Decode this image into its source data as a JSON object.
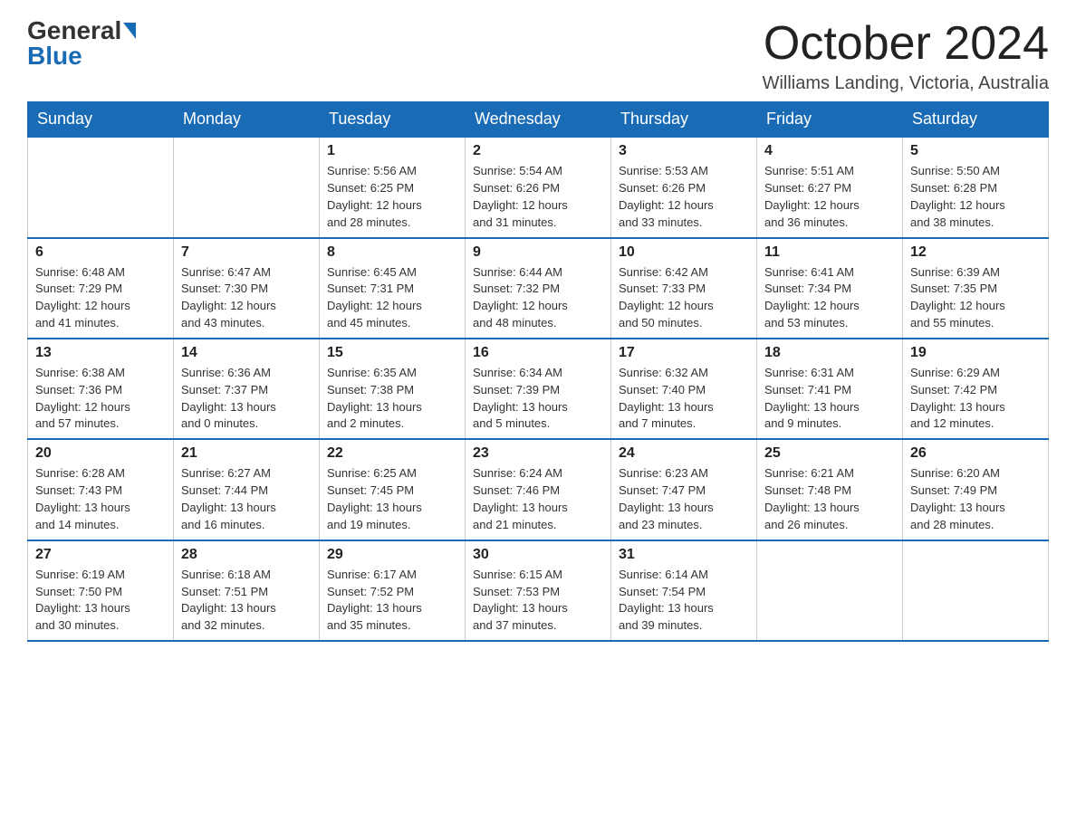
{
  "header": {
    "logo_line1": "General",
    "logo_arrow": "▶",
    "logo_line2": "Blue",
    "month_year": "October 2024",
    "location": "Williams Landing, Victoria, Australia"
  },
  "weekdays": [
    "Sunday",
    "Monday",
    "Tuesday",
    "Wednesday",
    "Thursday",
    "Friday",
    "Saturday"
  ],
  "weeks": [
    [
      {
        "day": "",
        "info": ""
      },
      {
        "day": "",
        "info": ""
      },
      {
        "day": "1",
        "info": "Sunrise: 5:56 AM\nSunset: 6:25 PM\nDaylight: 12 hours\nand 28 minutes."
      },
      {
        "day": "2",
        "info": "Sunrise: 5:54 AM\nSunset: 6:26 PM\nDaylight: 12 hours\nand 31 minutes."
      },
      {
        "day": "3",
        "info": "Sunrise: 5:53 AM\nSunset: 6:26 PM\nDaylight: 12 hours\nand 33 minutes."
      },
      {
        "day": "4",
        "info": "Sunrise: 5:51 AM\nSunset: 6:27 PM\nDaylight: 12 hours\nand 36 minutes."
      },
      {
        "day": "5",
        "info": "Sunrise: 5:50 AM\nSunset: 6:28 PM\nDaylight: 12 hours\nand 38 minutes."
      }
    ],
    [
      {
        "day": "6",
        "info": "Sunrise: 6:48 AM\nSunset: 7:29 PM\nDaylight: 12 hours\nand 41 minutes."
      },
      {
        "day": "7",
        "info": "Sunrise: 6:47 AM\nSunset: 7:30 PM\nDaylight: 12 hours\nand 43 minutes."
      },
      {
        "day": "8",
        "info": "Sunrise: 6:45 AM\nSunset: 7:31 PM\nDaylight: 12 hours\nand 45 minutes."
      },
      {
        "day": "9",
        "info": "Sunrise: 6:44 AM\nSunset: 7:32 PM\nDaylight: 12 hours\nand 48 minutes."
      },
      {
        "day": "10",
        "info": "Sunrise: 6:42 AM\nSunset: 7:33 PM\nDaylight: 12 hours\nand 50 minutes."
      },
      {
        "day": "11",
        "info": "Sunrise: 6:41 AM\nSunset: 7:34 PM\nDaylight: 12 hours\nand 53 minutes."
      },
      {
        "day": "12",
        "info": "Sunrise: 6:39 AM\nSunset: 7:35 PM\nDaylight: 12 hours\nand 55 minutes."
      }
    ],
    [
      {
        "day": "13",
        "info": "Sunrise: 6:38 AM\nSunset: 7:36 PM\nDaylight: 12 hours\nand 57 minutes."
      },
      {
        "day": "14",
        "info": "Sunrise: 6:36 AM\nSunset: 7:37 PM\nDaylight: 13 hours\nand 0 minutes."
      },
      {
        "day": "15",
        "info": "Sunrise: 6:35 AM\nSunset: 7:38 PM\nDaylight: 13 hours\nand 2 minutes."
      },
      {
        "day": "16",
        "info": "Sunrise: 6:34 AM\nSunset: 7:39 PM\nDaylight: 13 hours\nand 5 minutes."
      },
      {
        "day": "17",
        "info": "Sunrise: 6:32 AM\nSunset: 7:40 PM\nDaylight: 13 hours\nand 7 minutes."
      },
      {
        "day": "18",
        "info": "Sunrise: 6:31 AM\nSunset: 7:41 PM\nDaylight: 13 hours\nand 9 minutes."
      },
      {
        "day": "19",
        "info": "Sunrise: 6:29 AM\nSunset: 7:42 PM\nDaylight: 13 hours\nand 12 minutes."
      }
    ],
    [
      {
        "day": "20",
        "info": "Sunrise: 6:28 AM\nSunset: 7:43 PM\nDaylight: 13 hours\nand 14 minutes."
      },
      {
        "day": "21",
        "info": "Sunrise: 6:27 AM\nSunset: 7:44 PM\nDaylight: 13 hours\nand 16 minutes."
      },
      {
        "day": "22",
        "info": "Sunrise: 6:25 AM\nSunset: 7:45 PM\nDaylight: 13 hours\nand 19 minutes."
      },
      {
        "day": "23",
        "info": "Sunrise: 6:24 AM\nSunset: 7:46 PM\nDaylight: 13 hours\nand 21 minutes."
      },
      {
        "day": "24",
        "info": "Sunrise: 6:23 AM\nSunset: 7:47 PM\nDaylight: 13 hours\nand 23 minutes."
      },
      {
        "day": "25",
        "info": "Sunrise: 6:21 AM\nSunset: 7:48 PM\nDaylight: 13 hours\nand 26 minutes."
      },
      {
        "day": "26",
        "info": "Sunrise: 6:20 AM\nSunset: 7:49 PM\nDaylight: 13 hours\nand 28 minutes."
      }
    ],
    [
      {
        "day": "27",
        "info": "Sunrise: 6:19 AM\nSunset: 7:50 PM\nDaylight: 13 hours\nand 30 minutes."
      },
      {
        "day": "28",
        "info": "Sunrise: 6:18 AM\nSunset: 7:51 PM\nDaylight: 13 hours\nand 32 minutes."
      },
      {
        "day": "29",
        "info": "Sunrise: 6:17 AM\nSunset: 7:52 PM\nDaylight: 13 hours\nand 35 minutes."
      },
      {
        "day": "30",
        "info": "Sunrise: 6:15 AM\nSunset: 7:53 PM\nDaylight: 13 hours\nand 37 minutes."
      },
      {
        "day": "31",
        "info": "Sunrise: 6:14 AM\nSunset: 7:54 PM\nDaylight: 13 hours\nand 39 minutes."
      },
      {
        "day": "",
        "info": ""
      },
      {
        "day": "",
        "info": ""
      }
    ]
  ]
}
